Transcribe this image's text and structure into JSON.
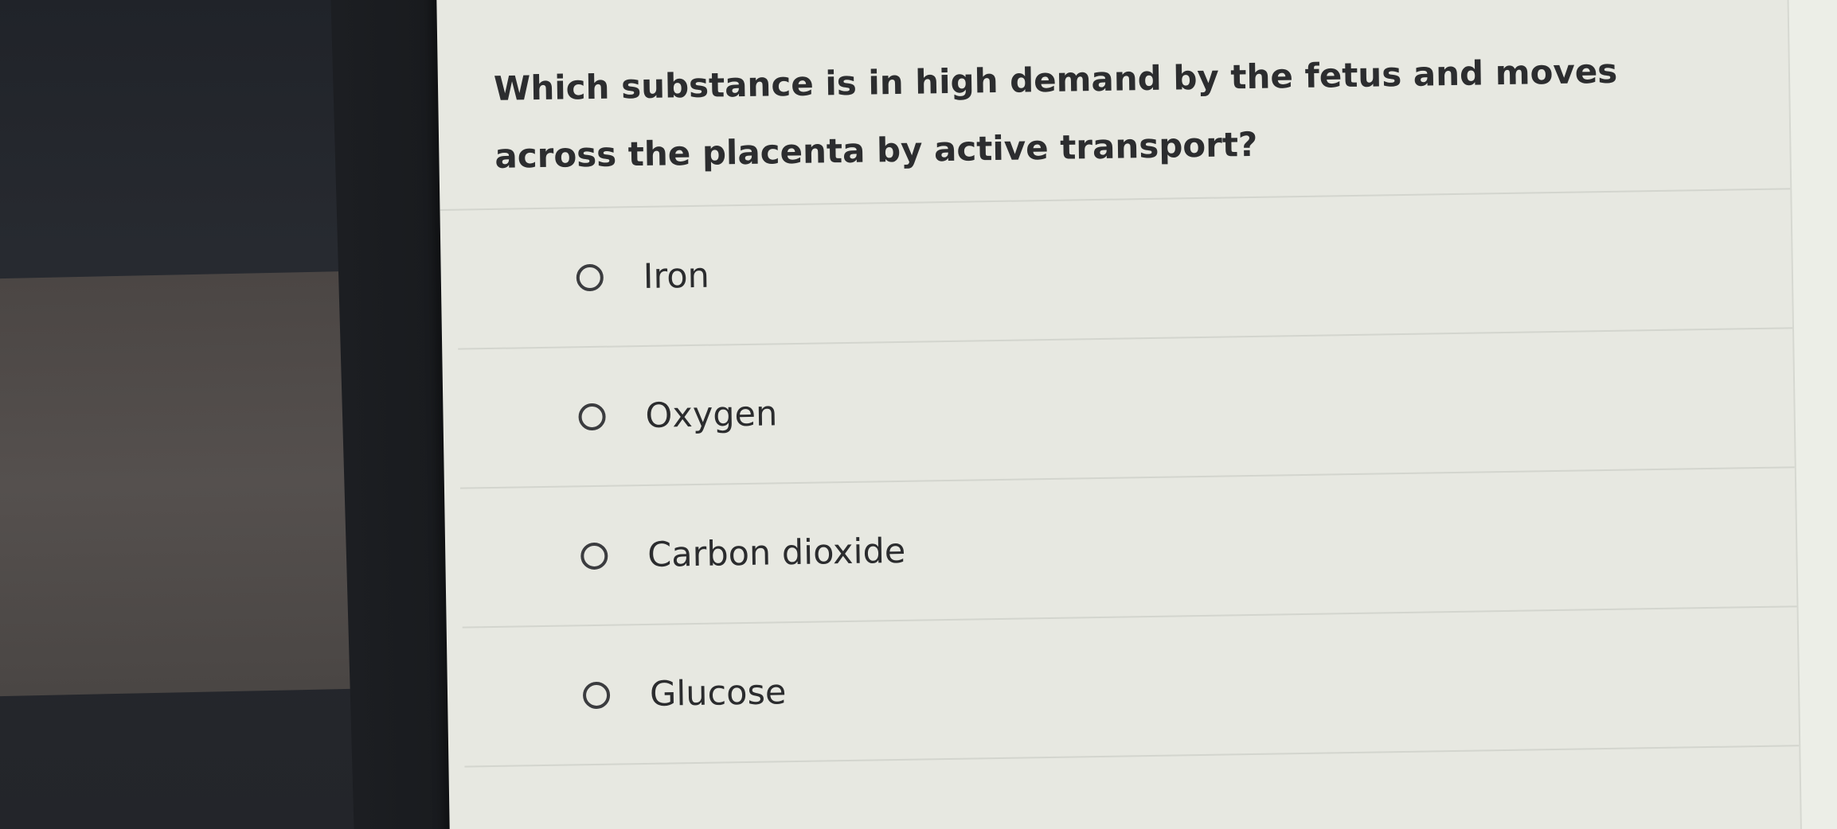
{
  "quiz": {
    "question": "Which substance is in high demand by the fetus and moves across the placenta by active transport?",
    "options": [
      {
        "label": "Iron",
        "selected": false
      },
      {
        "label": "Oxygen",
        "selected": false
      },
      {
        "label": "Carbon dioxide",
        "selected": false
      },
      {
        "label": "Glucose",
        "selected": false
      }
    ]
  },
  "colors": {
    "panel_background": "#e7e8e1",
    "text": "#2c2d2f",
    "divider": "#d3d5ce",
    "radio_border": "#3b3c3f"
  }
}
